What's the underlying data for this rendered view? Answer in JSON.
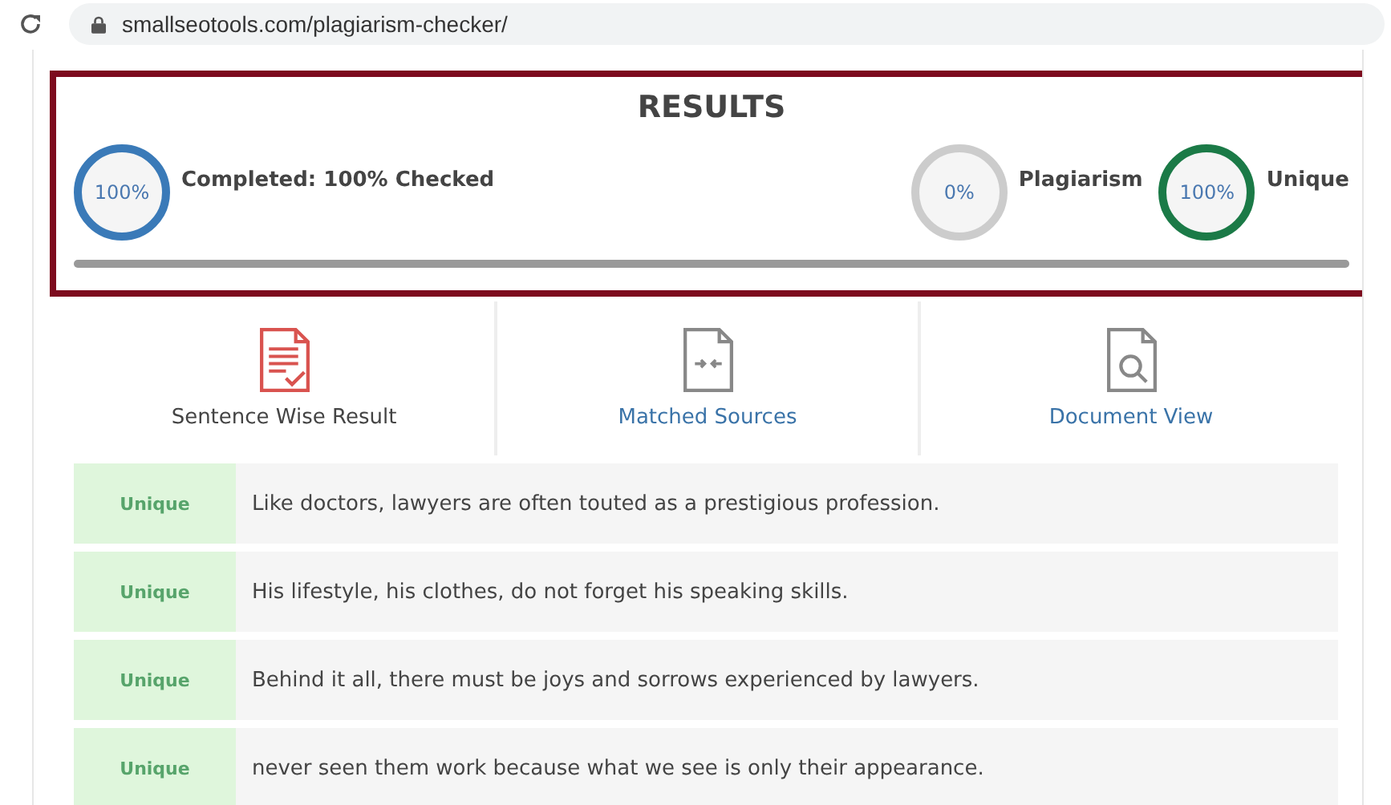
{
  "browser": {
    "url": "smallseotools.com/plagiarism-checker/"
  },
  "results": {
    "title": "RESULTS",
    "stats": [
      {
        "value": "100%",
        "label": "Completed: 100% Checked",
        "color": "#3a7ab8"
      },
      {
        "value": "0%",
        "label": "Plagiarism",
        "color": "#cccccc"
      },
      {
        "value": "100%",
        "label": "Unique",
        "color": "#1b7a47"
      }
    ],
    "progress": {
      "level": 1
    }
  },
  "tabs": [
    {
      "label": "Sentence Wise Result",
      "kind": "sentences",
      "selected": true
    },
    {
      "label": "Matched Sources",
      "kind": "compare",
      "selected": false
    },
    {
      "label": "Document View",
      "kind": "search",
      "selected": false
    }
  ],
  "sentences": [
    {
      "status": "Unique",
      "text": "Like doctors, lawyers are often touted as a prestigious profession."
    },
    {
      "status": "Unique",
      "text": "His lifestyle, his clothes, do not forget his speaking skills."
    },
    {
      "status": "Unique",
      "text": "Behind it all, there must be joys and sorrows experienced by lawyers."
    },
    {
      "status": "Unique",
      "text": "never seen them work because what we see is only their appearance."
    }
  ]
}
